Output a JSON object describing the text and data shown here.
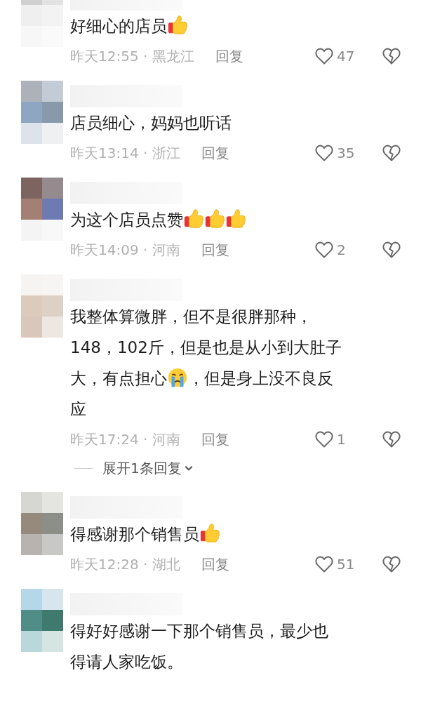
{
  "comments": [
    {
      "body": [
        [
          {
            "kind": "text",
            "text": "好细心的店员"
          },
          {
            "kind": "thumbs_up"
          }
        ]
      ],
      "time_place": "昨天12:55 · 黑龙江",
      "reply": "回复",
      "likes": "47"
    },
    {
      "body": [
        [
          {
            "kind": "text",
            "text": "店员细心，妈妈也听话"
          }
        ]
      ],
      "time_place": "昨天13:14 · 浙江",
      "reply": "回复",
      "likes": "35"
    },
    {
      "body": [
        [
          {
            "kind": "text",
            "text": "为这个店员点赞"
          },
          {
            "kind": "thumbs_up"
          },
          {
            "kind": "thumbs_up"
          },
          {
            "kind": "thumbs_up"
          }
        ]
      ],
      "time_place": "昨天14:09 · 河南",
      "reply": "回复",
      "likes": "2"
    },
    {
      "body": [
        [
          {
            "kind": "text",
            "text": "我整体算微胖，但不是很胖那种，"
          }
        ],
        [
          {
            "kind": "text",
            "text": "148，102斤，但是也是从小到大肚子"
          }
        ],
        [
          {
            "kind": "text",
            "text": "大，有点担心"
          },
          {
            "kind": "crying"
          },
          {
            "kind": "text",
            "text": "，但是身上没不良反"
          }
        ],
        [
          {
            "kind": "text",
            "text": "应"
          }
        ]
      ],
      "time_place": "昨天17:24 · 河南",
      "reply": "回复",
      "likes": "1",
      "expand": "展开1条回复"
    },
    {
      "body": [
        [
          {
            "kind": "text",
            "text": "得感谢那个销售员"
          },
          {
            "kind": "thumbs_up"
          }
        ]
      ],
      "time_place": "昨天12:28 · 湖北",
      "reply": "回复",
      "likes": "51"
    },
    {
      "body": [
        [
          {
            "kind": "text",
            "text": "得好好感谢一下那个销售员，最少也"
          }
        ],
        [
          {
            "kind": "text",
            "text": "得请人家吃饭。"
          }
        ]
      ]
    }
  ]
}
